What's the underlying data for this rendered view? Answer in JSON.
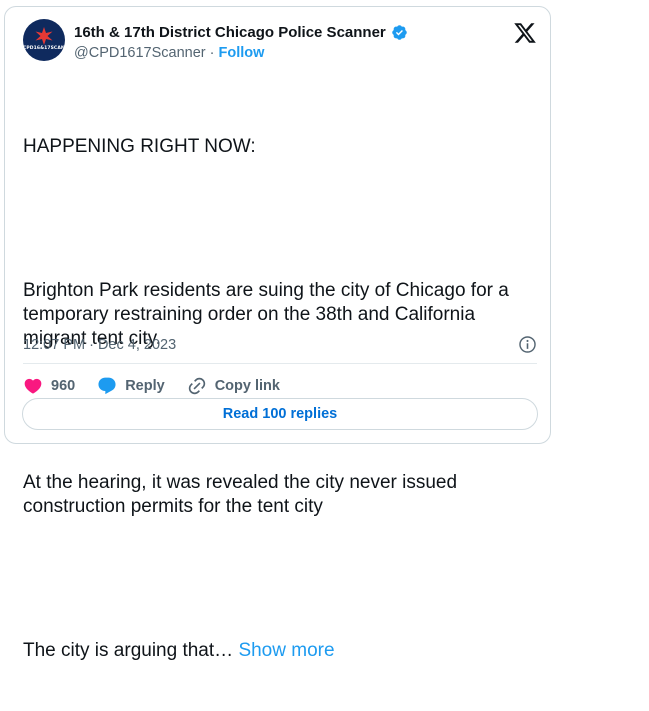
{
  "author": {
    "display_name": "16th & 17th District Chicago Police Scanner",
    "handle": "@CPD1617Scanner",
    "separator": " · ",
    "follow_label": "Follow",
    "avatar_text": "CPD16&17SCANNER",
    "avatar_color": "#0f2a5e",
    "verified_color": "#1d9bf0"
  },
  "tweet": {
    "paragraphs": [
      "HAPPENING RIGHT NOW:",
      "Brighton Park residents are suing the city of Chicago for a temporary restraining order on the 38th and California migrant tent city.",
      "At the hearing, it was revealed the city never issued construction permits for the tent city",
      "The city is arguing that… "
    ],
    "show_more_label": "Show more",
    "timestamp": "12:07 PM · Dec 4, 2023"
  },
  "actions": {
    "like_count": "960",
    "reply_label": "Reply",
    "copy_link_label": "Copy link",
    "read_replies_label": "Read 100 replies"
  },
  "icons": {
    "x_logo": "x-logo-icon",
    "info": "info-icon",
    "heart": "heart-icon",
    "reply": "reply-bubble-icon",
    "link": "link-icon",
    "verified": "verified-badge-icon"
  },
  "colors": {
    "accent": "#1d9bf0",
    "like": "#f91880",
    "text": "#0f1419",
    "muted": "#536471"
  }
}
